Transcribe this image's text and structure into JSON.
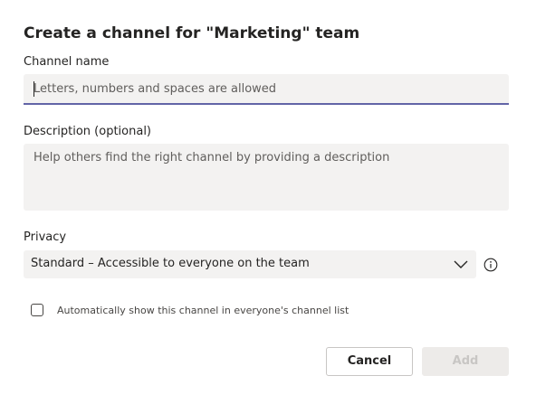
{
  "dialog": {
    "title": "Create a channel for \"Marketing\" team"
  },
  "channel_name": {
    "label": "Channel name",
    "value": "",
    "placeholder": "Letters, numbers and spaces are allowed"
  },
  "description": {
    "label": "Description (optional)",
    "value": "",
    "placeholder": "Help others find the right channel by providing a description"
  },
  "privacy": {
    "label": "Privacy",
    "selected": "Standard – Accessible to everyone on the team",
    "dropdown_icon": "chevron-down-icon",
    "help_icon": "info-icon"
  },
  "auto_show": {
    "checked": false,
    "label": "Automatically show this channel in everyone's channel list"
  },
  "buttons": {
    "cancel": "Cancel",
    "add": "Add",
    "add_enabled": false
  },
  "colors": {
    "accent": "#6264a7",
    "field_bg": "#f3f2f1",
    "text": "#252423",
    "disabled_text": "#c8c6c4"
  }
}
